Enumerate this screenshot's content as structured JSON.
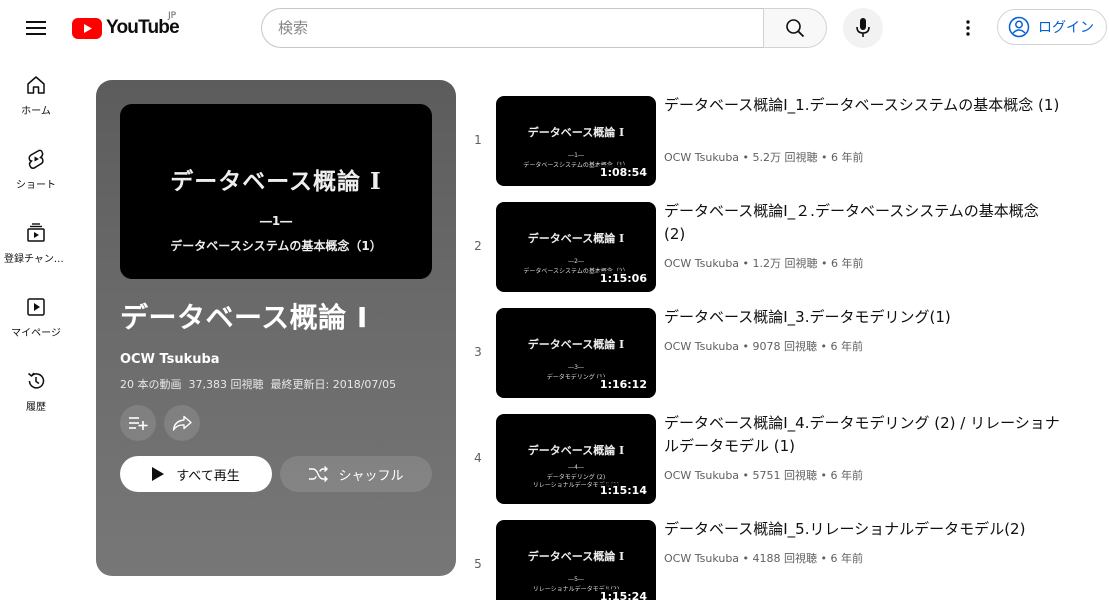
{
  "header": {
    "logo_text": "YouTube",
    "logo_region": "JP",
    "search_placeholder": "検索",
    "login_label": "ログイン"
  },
  "sidebar": {
    "items": [
      {
        "label": "ホーム",
        "icon": "home-icon"
      },
      {
        "label": "ショート",
        "icon": "shorts-icon"
      },
      {
        "label": "登録チャンネル",
        "icon": "subscriptions-icon"
      },
      {
        "label": "マイページ",
        "icon": "library-icon"
      },
      {
        "label": "履歴",
        "icon": "history-icon"
      }
    ]
  },
  "playlist": {
    "thumb_title": "データベース概論 Ⅰ",
    "thumb_number": "―1―",
    "thumb_subtitle": "データベースシステムの基本概念（1）",
    "title": "データベース概論 I",
    "channel": "OCW Tsukuba",
    "video_count": "20 本の動画",
    "view_count": "37,383 回視聴",
    "last_updated": "最終更新日: 2018/07/05",
    "play_all_label": "すべて再生",
    "shuffle_label": "シャッフル"
  },
  "videos": [
    {
      "index": "1",
      "title": "データベース概論Ⅰ_1.データベースシステムの基本概念 (1)",
      "meta": "OCW Tsukuba • 5.2万 回視聴 • 6 年前",
      "duration": "1:08:54",
      "thumb_title": "データベース概論 Ⅰ",
      "thumb_number": "―1―",
      "thumb_subtitle": "データベースシステムの基本概念（1）"
    },
    {
      "index": "2",
      "title": "データベース概論Ⅰ_２.データベースシステムの基本概念 (2)",
      "meta": "OCW Tsukuba • 1.2万 回視聴 • 6 年前",
      "duration": "1:15:06",
      "thumb_title": "データベース概論 Ⅰ",
      "thumb_number": "―2―",
      "thumb_subtitle": "データベースシステムの基本概念（2）"
    },
    {
      "index": "3",
      "title": "データベース概論Ⅰ_3.データモデリング(1)",
      "meta": "OCW Tsukuba • 9078 回視聴 • 6 年前",
      "duration": "1:16:12",
      "thumb_title": "データベース概論 Ⅰ",
      "thumb_number": "―3―",
      "thumb_subtitle": "データモデリング (1)"
    },
    {
      "index": "4",
      "title": "データベース概論Ⅰ_4.データモデリング (2) / リレーショナルデータモデル (1)",
      "meta": "OCW Tsukuba • 5751 回視聴 • 6 年前",
      "duration": "1:15:14",
      "thumb_title": "データベース概論 Ⅰ",
      "thumb_number": "―4―",
      "thumb_subtitle": "データモデリング (2)",
      "thumb_subtitle2": "リレーショナルデータモデル(1)"
    },
    {
      "index": "5",
      "title": "データベース概論Ⅰ_5.リレーショナルデータモデル(2)",
      "meta": "OCW Tsukuba • 4188 回視聴 • 6 年前",
      "duration": "1:15:24",
      "thumb_title": "データベース概論 Ⅰ",
      "thumb_number": "―5―",
      "thumb_subtitle": "リレーショナルデータモデル(2)"
    }
  ],
  "colors": {
    "brand_red": "#ff0000",
    "link_blue": "#065fd4",
    "card_gray": "#6a6a6a"
  }
}
